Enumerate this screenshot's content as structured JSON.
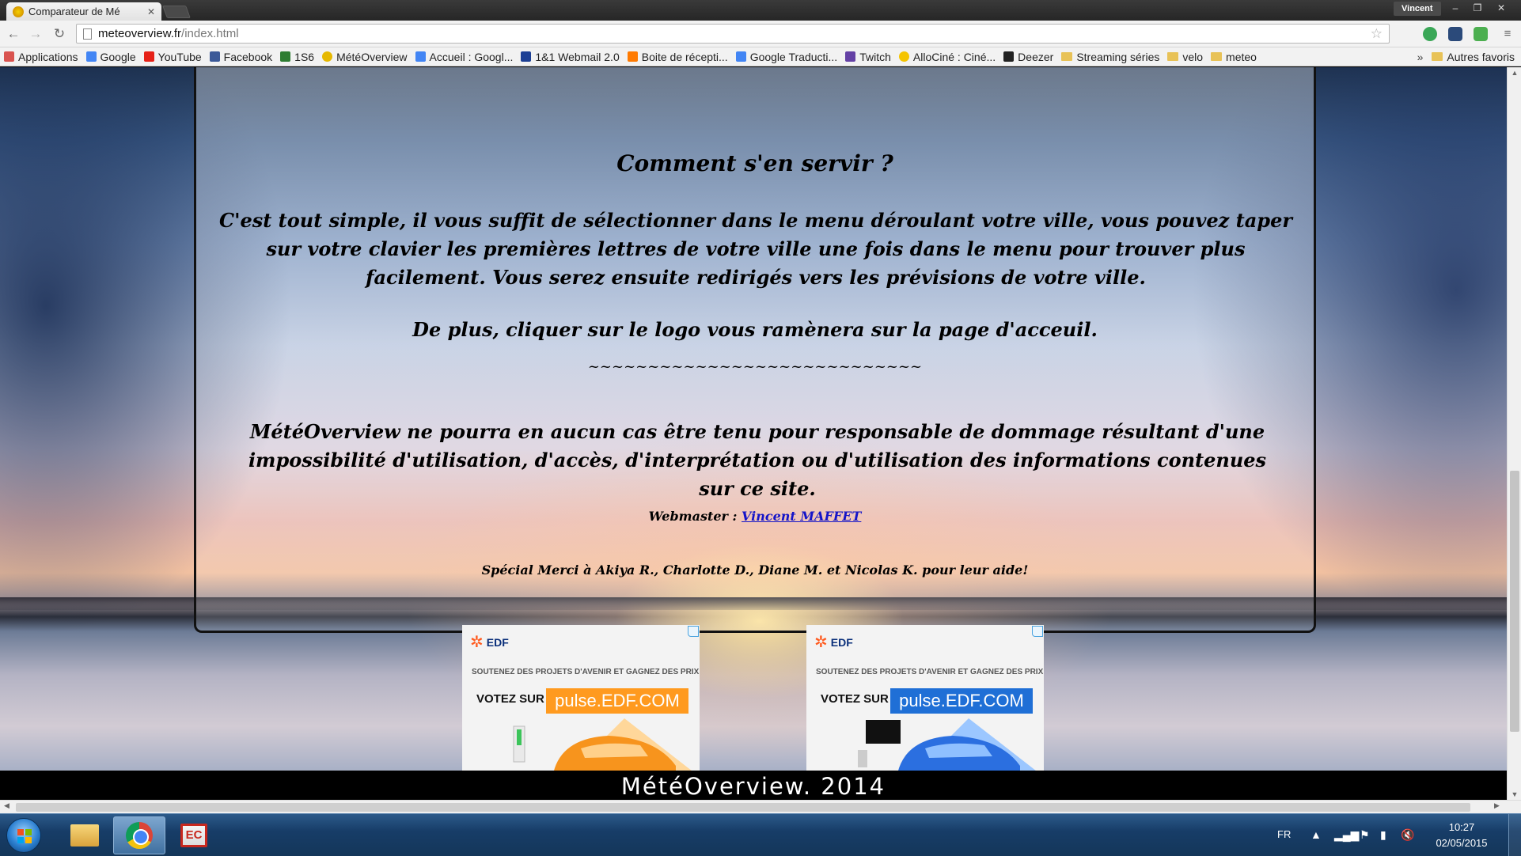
{
  "browser": {
    "tab_title": "Comparateur de Mé",
    "user_name": "Vincent",
    "address_host": "meteoverview.fr",
    "address_path": "/index.html",
    "bookmarks": [
      {
        "label": "Applications",
        "icon": "apps-grid-icon",
        "color": "#d9534f"
      },
      {
        "label": "Google",
        "icon": "google-icon",
        "color": "#4285f4"
      },
      {
        "label": "YouTube",
        "icon": "youtube-icon",
        "color": "#e62117"
      },
      {
        "label": "Facebook",
        "icon": "facebook-icon",
        "color": "#3b5998"
      },
      {
        "label": "1S6",
        "icon": "leaf-icon",
        "color": "#2e7d32"
      },
      {
        "label": "MétéOverview",
        "icon": "sun-icon",
        "color": "#e6b800"
      },
      {
        "label": "Accueil : Googl...",
        "icon": "google-icon",
        "color": "#4285f4"
      },
      {
        "label": "1&1 Webmail 2.0",
        "icon": "webmail-icon",
        "color": "#1c3f94"
      },
      {
        "label": "Boite de récepti...",
        "icon": "mailbox-icon",
        "color": "#ff7a00"
      },
      {
        "label": "Google Traducti...",
        "icon": "translate-icon",
        "color": "#4285f4"
      },
      {
        "label": "Twitch",
        "icon": "twitch-icon",
        "color": "#6441a5"
      },
      {
        "label": "AlloCiné : Ciné...",
        "icon": "allocine-icon",
        "color": "#f5c400"
      },
      {
        "label": "Deezer",
        "icon": "deezer-icon",
        "color": "#222222"
      },
      {
        "label": "Streaming séries",
        "icon": "folder-icon",
        "color": "#e8c257"
      },
      {
        "label": "velo",
        "icon": "folder-icon",
        "color": "#e8c257"
      },
      {
        "label": "meteo",
        "icon": "folder-icon",
        "color": "#e8c257"
      }
    ],
    "more_label": "»",
    "other_bookmarks_label": "Autres favoris"
  },
  "page": {
    "heading": "Comment s'en servir ?",
    "paragraph1": "C'est tout simple, il vous suffit de sélectionner dans le menu déroulant votre ville, vous pouvez taper sur votre clavier les premières lettres de votre ville une fois dans le menu pour trouver plus facilement. Vous serez ensuite redirigés vers les prévisions de votre ville.",
    "paragraph2": "De plus, cliquer sur le logo vous ramènera sur la page d'acceuil.",
    "separator": "~~~~~~~~~~~~~~~~~~~~~~~~~~~~",
    "disclaimer": "MétéOverview ne pourra en aucun cas être tenu pour responsable de dommage résultant d'une impossibilité d'utilisation, d'accès, d'interprétation ou d'utilisation des informations contenues sur ce site.",
    "webmaster_label": "Webmaster :",
    "webmaster_name": "Vincent MAFFET",
    "thanks": "Spécial Merci à Akiya R., Charlotte D., Diane M. et Nicolas K. pour leur aide!",
    "footer": "MétéOverview. 2014"
  },
  "ads": [
    {
      "brand": "EDF",
      "tagline": "SOUTENEZ DES PROJETS D'AVENIR ET GAGNEZ DES PRIX",
      "cta": "VOTEZ SUR",
      "site": "pulse.EDF.COM",
      "accent": "#ff9a1f"
    },
    {
      "brand": "EDF",
      "tagline": "SOUTENEZ DES PROJETS D'AVENIR ET GAGNEZ DES PRIX",
      "cta": "VOTEZ SUR",
      "site": "pulse.EDF.COM",
      "accent": "#1f6fd6"
    }
  ],
  "taskbar": {
    "language": "FR",
    "time": "10:27",
    "date": "02/05/2015"
  }
}
